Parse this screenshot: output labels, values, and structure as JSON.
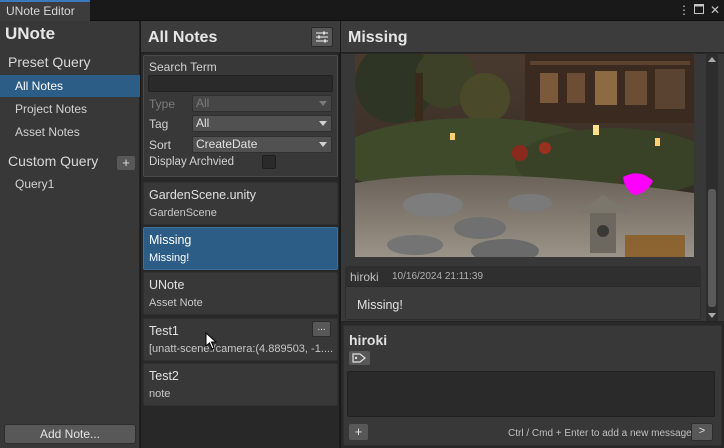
{
  "window": {
    "tab_title": "UNote Editor",
    "menu_icon": "kebab-menu-icon",
    "maximize_icon": "maximize-icon",
    "close_icon": "close-icon"
  },
  "left": {
    "app_title": "UNote",
    "preset_heading": "Preset Query",
    "preset_items": [
      {
        "label": "All Notes",
        "selected": true
      },
      {
        "label": "Project Notes",
        "selected": false
      },
      {
        "label": "Asset Notes",
        "selected": false
      }
    ],
    "custom_heading": "Custom Query",
    "add_query_label": "+",
    "custom_items": [
      {
        "label": "Query1"
      }
    ],
    "add_note_label": "Add Note..."
  },
  "middle": {
    "title": "All Notes",
    "filter_icon": "sliders-icon",
    "query": {
      "search_label": "Search Term",
      "search_value": "",
      "type_label": "Type",
      "type_value": "All",
      "tag_label": "Tag",
      "tag_value": "All",
      "sort_label": "Sort",
      "sort_value": "CreateDate",
      "archived_label": "Display Archvied",
      "archived_checked": false
    },
    "notes": [
      {
        "title": "GardenScene.unity",
        "subtitle": "GardenScene",
        "selected": false
      },
      {
        "title": "Missing",
        "subtitle": "Missing!",
        "selected": true
      },
      {
        "title": "UNote",
        "subtitle": "Asset Note",
        "selected": false
      },
      {
        "title": "Test1",
        "subtitle": "[unatt-scene:/camera:(4.889503, -1....",
        "selected": false,
        "more_label": "..."
      },
      {
        "title": "Test2",
        "subtitle": "note",
        "selected": false
      }
    ]
  },
  "right": {
    "title": "Missing",
    "message": {
      "author": "hiroki",
      "date": "10/16/2024 21:11:39",
      "text": "Missing!"
    },
    "compose": {
      "author": "hiroki",
      "tag_icon": "tag-icon",
      "add_label": "+",
      "hint": "Ctrl / Cmd + Enter to add a new message",
      "send_label": ">"
    }
  },
  "colors": {
    "accent_selected": "#2c5d87",
    "panel": "#383838",
    "background": "#282828",
    "header": "#3c3c3c",
    "tab_accent": "#3a79bb",
    "magenta_marker": "#ff00ff"
  }
}
